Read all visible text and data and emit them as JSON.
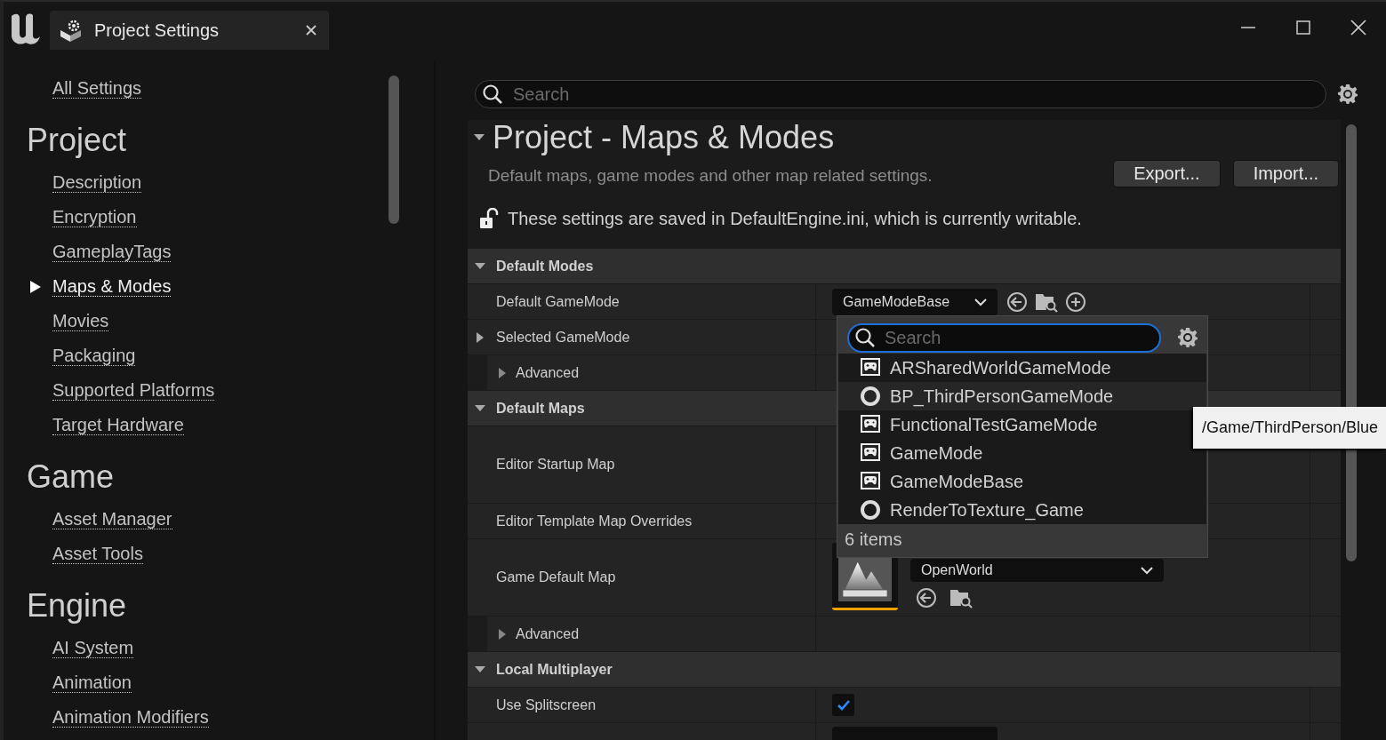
{
  "window": {
    "title": "Project Settings"
  },
  "sidebar": {
    "top_links": [
      {
        "label": "All Settings",
        "selected": false
      }
    ],
    "sections": [
      {
        "title": "Project",
        "items": [
          {
            "label": "Description",
            "selected": false
          },
          {
            "label": "Encryption",
            "selected": false
          },
          {
            "label": "GameplayTags",
            "selected": false
          },
          {
            "label": "Maps & Modes",
            "selected": true
          },
          {
            "label": "Movies",
            "selected": false
          },
          {
            "label": "Packaging",
            "selected": false
          },
          {
            "label": "Supported Platforms",
            "selected": false
          },
          {
            "label": "Target Hardware",
            "selected": false
          }
        ]
      },
      {
        "title": "Game",
        "items": [
          {
            "label": "Asset Manager",
            "selected": false
          },
          {
            "label": "Asset Tools",
            "selected": false
          }
        ]
      },
      {
        "title": "Engine",
        "items": [
          {
            "label": "AI System",
            "selected": false
          },
          {
            "label": "Animation",
            "selected": false
          },
          {
            "label": "Animation Modifiers",
            "selected": false
          }
        ]
      }
    ]
  },
  "search": {
    "placeholder": "Search"
  },
  "panel": {
    "title": "Project - Maps & Modes",
    "expanded": true,
    "description": "Default maps, game modes and other map related settings.",
    "buttons": [
      "Export...",
      "Import..."
    ],
    "config_note": "These settings are saved in DefaultEngine.ini, which is currently writable."
  },
  "categories": [
    {
      "title": "Default Modes",
      "expanded": true,
      "rows": [
        {
          "kind": "class_picker",
          "label": "Default GameMode",
          "value": "GameModeBase"
        },
        {
          "kind": "expandable",
          "label": "Selected GameMode",
          "expanded": false
        },
        {
          "kind": "advanced",
          "label": "Advanced",
          "expanded": false
        }
      ]
    },
    {
      "title": "Default Maps",
      "expanded": true,
      "rows": [
        {
          "kind": "map_slot",
          "label": "Editor Startup Map"
        },
        {
          "kind": "empty",
          "label": "Editor Template Map Overrides"
        },
        {
          "kind": "map_picker",
          "label": "Game Default Map",
          "value": "OpenWorld"
        },
        {
          "kind": "advanced",
          "label": "Advanced",
          "expanded": false
        }
      ]
    },
    {
      "title": "Local Multiplayer",
      "expanded": true,
      "rows": [
        {
          "kind": "checkbox",
          "label": "Use Splitscreen",
          "checked": true
        },
        {
          "kind": "cut"
        }
      ]
    }
  ],
  "picker_popup": {
    "placeholder": "Search",
    "items": [
      {
        "kind": "native",
        "label": "ARSharedWorldGameMode",
        "highlighted": false
      },
      {
        "kind": "blueprint",
        "label": "BP_ThirdPersonGameMode",
        "highlighted": true
      },
      {
        "kind": "native",
        "label": "FunctionalTestGameMode",
        "highlighted": false
      },
      {
        "kind": "native",
        "label": "GameMode",
        "highlighted": false
      },
      {
        "kind": "native",
        "label": "GameModeBase",
        "highlighted": false
      },
      {
        "kind": "blueprint",
        "label": "RenderToTexture_Game",
        "highlighted": false
      }
    ],
    "count": "6 items"
  },
  "tooltip": {
    "text": "/Game/ThirdPerson/Blue"
  }
}
